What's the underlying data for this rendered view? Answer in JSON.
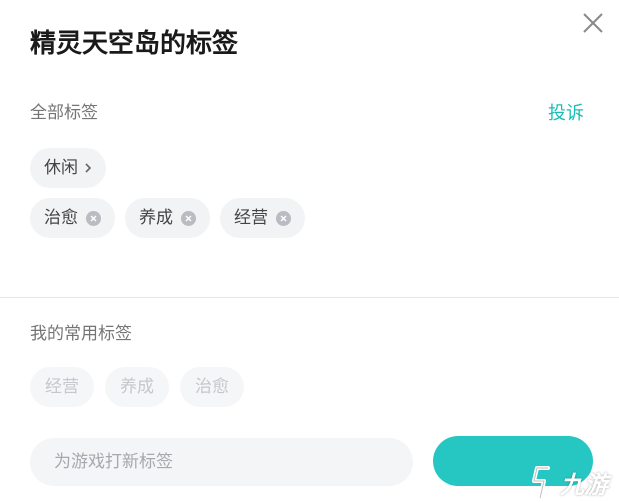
{
  "dialog": {
    "title": "精灵天空岛的标签",
    "report_label": "投诉",
    "close_icon": "close-icon"
  },
  "all_tags": {
    "label": "全部标签",
    "category": {
      "label": "休闲",
      "icon": "chevron-right-icon"
    },
    "tags": [
      {
        "label": "治愈",
        "icon": "remove-icon"
      },
      {
        "label": "养成",
        "icon": "remove-icon"
      },
      {
        "label": "经营",
        "icon": "remove-icon"
      }
    ]
  },
  "frequent_tags": {
    "label": "我的常用标签",
    "tags": [
      "经营",
      "养成",
      "治愈"
    ]
  },
  "new_tag": {
    "placeholder": "为游戏打新标签",
    "value": ""
  },
  "watermark": {
    "text": "九游",
    "icon": "jiuyou-logo-icon"
  },
  "colors": {
    "accent": "#19bcb8",
    "button": "#26c7c3",
    "chip_bg": "#f1f3f5",
    "title": "#1a1a1a"
  }
}
